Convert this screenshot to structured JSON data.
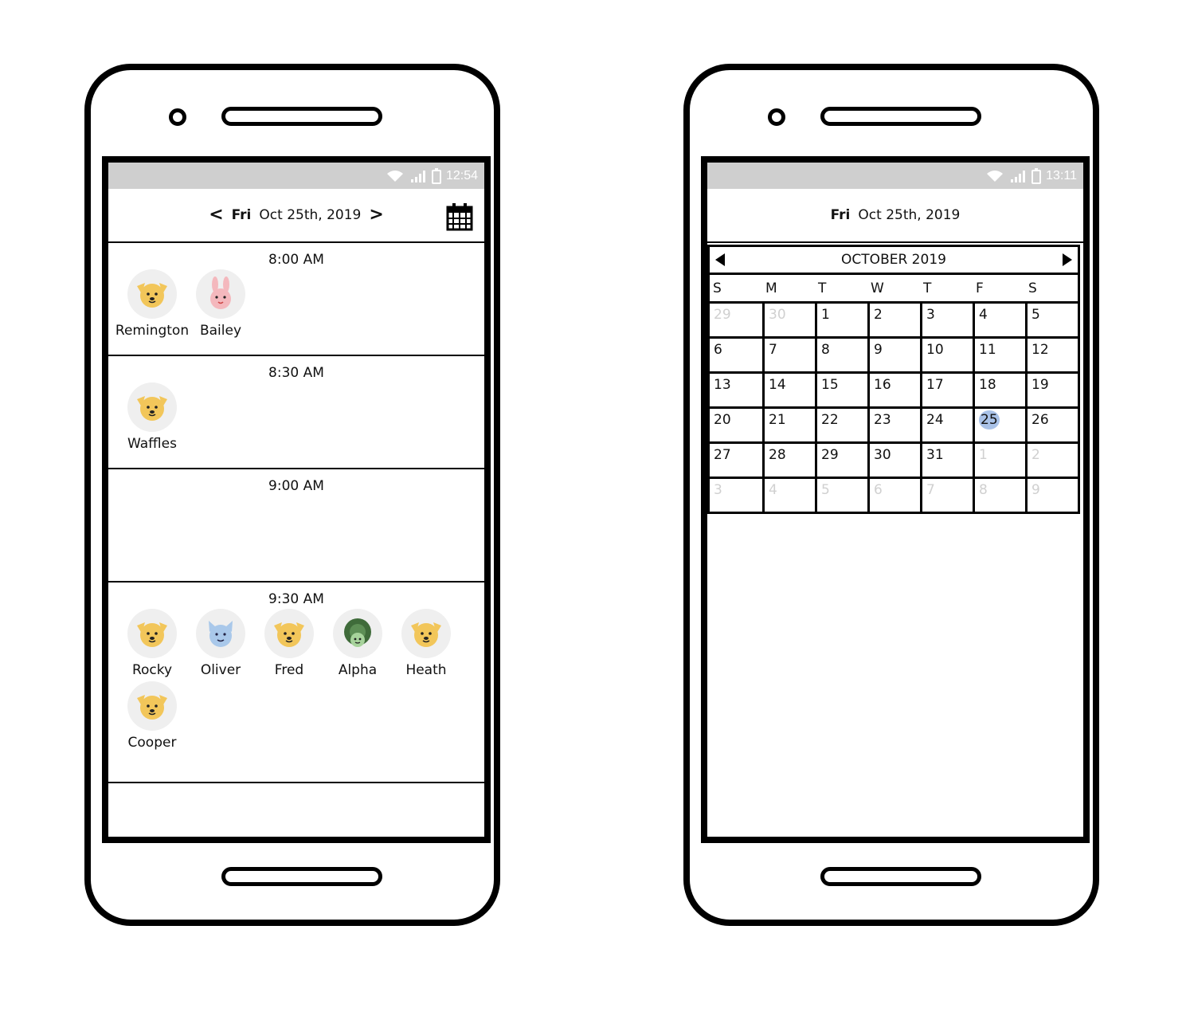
{
  "left_phone": {
    "status_time": "12:54",
    "header": {
      "weekday": "Fri",
      "date": "Oct 25th, 2019",
      "prev": "<",
      "next": ">"
    },
    "slots": [
      {
        "time": "8:00 AM",
        "pets": [
          {
            "name": "Remington",
            "icon": "dog-icon"
          },
          {
            "name": "Bailey",
            "icon": "rabbit-icon"
          }
        ]
      },
      {
        "time": "8:30 AM",
        "pets": [
          {
            "name": "Waffles",
            "icon": "dog-icon"
          }
        ]
      },
      {
        "time": "9:00 AM",
        "pets": []
      },
      {
        "time": "9:30 AM",
        "pets": [
          {
            "name": "Rocky",
            "icon": "dog-icon"
          },
          {
            "name": "Oliver",
            "icon": "cat-icon"
          },
          {
            "name": "Fred",
            "icon": "dog-icon"
          },
          {
            "name": "Alpha",
            "icon": "turtle-icon"
          },
          {
            "name": "Heath",
            "icon": "dog-icon"
          },
          {
            "name": "Cooper",
            "icon": "dog-icon"
          }
        ]
      }
    ]
  },
  "right_phone": {
    "status_time": "13:11",
    "header": {
      "weekday": "Fri",
      "date": "Oct 25th, 2019"
    },
    "calendar": {
      "month_label": "OCTOBER 2019",
      "weekdays": [
        "S",
        "M",
        "T",
        "W",
        "T",
        "F",
        "S"
      ],
      "weeks": [
        [
          "29",
          "30",
          "1",
          "2",
          "3",
          "4",
          "5"
        ],
        [
          "6",
          "7",
          "8",
          "9",
          "10",
          "11",
          "12"
        ],
        [
          "13",
          "14",
          "15",
          "16",
          "17",
          "18",
          "19"
        ],
        [
          "20",
          "21",
          "22",
          "23",
          "24",
          "25",
          "26"
        ],
        [
          "27",
          "28",
          "29",
          "30",
          "31",
          "1",
          "2"
        ],
        [
          "3",
          "4",
          "5",
          "6",
          "7",
          "8",
          "9"
        ]
      ],
      "selected": "25"
    }
  },
  "colors": {
    "dog": "#f2c65a",
    "rabbit": "#f4b8bd",
    "cat": "#a9c8ea",
    "turtle": "#3f6b3a",
    "selected": "#a9c2e8"
  }
}
